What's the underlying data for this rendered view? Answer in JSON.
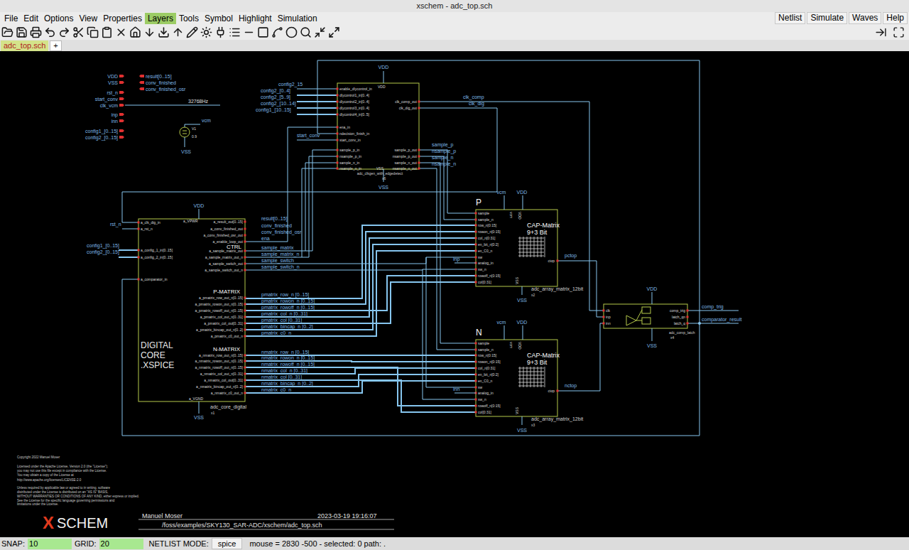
{
  "window": {
    "title": "xschem - adc_top.sch"
  },
  "menu": [
    {
      "label": "File",
      "selected": false
    },
    {
      "label": "Edit",
      "selected": false
    },
    {
      "label": "Options",
      "selected": false
    },
    {
      "label": "View",
      "selected": false
    },
    {
      "label": "Properties",
      "selected": false
    },
    {
      "label": "Layers",
      "selected": true
    },
    {
      "label": "Tools",
      "selected": false
    },
    {
      "label": "Symbol",
      "selected": false
    },
    {
      "label": "Highlight",
      "selected": false
    },
    {
      "label": "Simulation",
      "selected": false
    }
  ],
  "menu_right": [
    "Netlist",
    "Simulate",
    "Waves",
    "Help"
  ],
  "tabs": [
    {
      "label": "adc_top.sch",
      "selected": true
    }
  ],
  "new_tab": "+",
  "schematic": {
    "io_pins": {
      "inputs": [
        "VDD",
        "VSS",
        "rst_n",
        "start_conv",
        "clk_vcm",
        "inp",
        "inn",
        "config1_[0..15]",
        "config2_[0..15]"
      ],
      "outputs": [
        "result[0..15]",
        "conv_finished",
        "conv_finished_osr"
      ]
    },
    "clock_source": "32768Hz",
    "vsource": {
      "net": "vcm",
      "name": "V1",
      "value": "0.9",
      "ground": "VSS"
    },
    "clkgen": {
      "supply": "VDD",
      "supply_pin": "VDD",
      "ground": "VSS",
      "ground_pin": "VSS",
      "cell": "adc_clkgen_with_edgedetect",
      "instance": "x6",
      "left_pins": [
        "enable_dlycontrol_in",
        "dlycontrol1_in[0..4]",
        "dlycontrol2_in[0..4]",
        "dlycontrol3_in[0..4]",
        "dlycontrol4_in[0..5]",
        "ena_in",
        "ndecision_finish_in",
        "start_conv_in",
        "sample_p_in",
        "nsample_p_in",
        "sample_n_in",
        "nsample_n_in"
      ],
      "right_pins": [
        "clk_comp_out",
        "clk_dig_out",
        "sample_p_out",
        "nsample_p_out",
        "sample_n_out",
        "nsample_n_out"
      ],
      "left_nets": [
        "config2_15",
        "config2_[0..4]",
        "config2_[5..9]",
        "config2_[10..14]",
        "config1_[10..15]",
        "start_conv"
      ],
      "right_nets": [
        "clk_comp",
        "clk_dig",
        "sample_p",
        "nsample_p",
        "sample_n",
        "nsample_n"
      ]
    },
    "digital": {
      "supply": "VDD",
      "supply_pin": "a_VPWR",
      "ground": "VSS",
      "ground_pin": "a_VGND",
      "title": [
        "DIGITAL",
        "CORE",
        ".XSPICE"
      ],
      "cell": "adc_core_digital",
      "instance": "x1",
      "left_pins": [
        "a_clk_dig_in",
        "a_rst_n",
        "a_config_1_in[0..15]",
        "a_config_2_in[0..15]",
        "a_comparator_in"
      ],
      "left_nets": [
        "rst_n",
        "config1_[0..15]",
        "config2_[0..15]"
      ],
      "sections": [
        "CTRL",
        "P-MATRIX",
        "N-MATRIX"
      ],
      "right_pins": [
        "a_result_out[0..15]",
        "a_conv_finished_out",
        "a_conv_finished_osr_out",
        "a_enable_loop_out",
        "a_sample_matrix_out",
        "a_sample_matrix_out_n",
        "a_sample_switch_out",
        "a_sample_switch_out_n",
        "a_pmatrix_row_out_n[0..15]",
        "a_pmatrix_rowon_out_n[0..15]",
        "a_pmatrix_rowoff_out_n[0..15]",
        "a_pmatrix_col_out_n[0..31]",
        "a_pmatrix_col_out[0..31]",
        "a_pmatrix_bincap_out_n[0..2]",
        "a_pmatrix_c0_out_n",
        "a_nmatrix_row_out_n[0..15]",
        "a_nmatrix_rowon_out_n[0..15]",
        "a_nmatrix_rowoff_out_n[0..15]",
        "a_nmatrix_col_out_n[0..31]",
        "a_nmatrix_col_out[0..31]",
        "a_nmatrix_bincap_out_n[0..2]",
        "a_nmatrix_c0_out_n"
      ],
      "right_nets": [
        "result[0..15]",
        "conv_finished",
        "conv_finished_osr",
        "ena",
        "sample_matrix",
        "sample_matrix_n",
        "sample_switch",
        "sample_switch_n",
        "pmatrix_row_n [0..15]",
        "pmatrix_rowon_n [0..15]",
        "pmatrix_rowoff_n [0..15]",
        "pmatrix_col_n [0..31]",
        "pmatrix_col [0..31]",
        "pmatrix_bincap_n [0..2]",
        "pmatrix_c0_n",
        "nmatrix_row_n [0..15]",
        "nmatrix_rowon_n [0..15]",
        "nmatrix_rowoff_n [0..15]",
        "nmatrix_col_n [0..31]",
        "nmatrix_col [0..31]",
        "nmatrix_bincap_n [0..2]",
        "nmatrix_c0_n"
      ]
    },
    "cap_matrices": [
      {
        "label": "P",
        "title": "CAP-Matrix",
        "subtitle": "9+3 Bit",
        "pins": [
          "sample",
          "sample_n",
          "row_n[0:15]",
          "rowon_n[0:15]",
          "col_n[0:31]",
          "en_bit_n[0:2]",
          "en_C0_n",
          "sw",
          "analog_in",
          "sw_n",
          "rowoff_n[0:15]",
          "col[0:31]"
        ],
        "top_pins": [
          "vcm",
          "VDD"
        ],
        "top_nets": [
          "vcm",
          "VDD"
        ],
        "ground_pin": "VSS",
        "ground": "VSS",
        "out_pin": "ctop",
        "out_net": "pctop",
        "in_net": "inp",
        "cell": "adc_array_matrix_12bit",
        "instance": "x2"
      },
      {
        "label": "N",
        "title": "CAP-Matrix",
        "subtitle": "9+3 Bit",
        "pins": [
          "sample",
          "sample_n",
          "row_n[0:15]",
          "rowon_n[0:15]",
          "col_n[0:31]",
          "en_bit_n[0:2]",
          "en_C0_n",
          "sw",
          "analog_in",
          "sw_n",
          "rowoff_n[0:15]",
          "col[0:31]"
        ],
        "top_pins": [
          "vcm",
          "VDD"
        ],
        "top_nets": [
          "vcm",
          "VDD"
        ],
        "ground_pin": "VSS",
        "ground": "VSS",
        "out_pin": "ctop",
        "out_net": "nctop",
        "in_net": "inn",
        "cell": "adc_array_matrix_12bit",
        "instance": "x3"
      }
    ],
    "comparator": {
      "left_pins": [
        "clk",
        "inp",
        "inn"
      ],
      "right_pins": [
        "comp_trig",
        "latch_qn",
        "latch_q"
      ],
      "supply": "VDD",
      "ground": "VSS",
      "cell": "adc_comp_latch",
      "instance": "x4",
      "out_nets": [
        "comp_trig",
        "comparator_result"
      ]
    },
    "license": [
      "Copyright 2022 Manuel Moser",
      "Licensed under the Apache License, Version 2.0 (the \"License\");",
      "you may not use this file except in compliance with the License.",
      "You may obtain a copy of the License at",
      "    http://www.apache.org/licenses/LICENSE-2.0",
      "Unless required by applicable law or agreed to in writing, software",
      "distributed under the License is distributed on an \"AS IS\" BASIS,",
      "WITHOUT WARRANTIES OR CONDITIONS OF ANY KIND, either express or implied.",
      "See the License for the specific language governing permissions and",
      "limitations under the License."
    ],
    "title_block": {
      "logo_mark": "X",
      "logo_text": "SCHEM",
      "author": "Manuel Moser",
      "date": "2023-03-19  19:16:07",
      "path": "/foss/examples/SKY130_SAR-ADC/xschem/adc_top.sch"
    }
  },
  "status_bar": {
    "snap_label": "SNAP:",
    "snap": "10",
    "grid_label": "GRID:",
    "grid": "20",
    "mode_label": "NETLIST MODE:",
    "mode": "spice",
    "info": "mouse = 2830 -500 - selected: 0 path: ."
  }
}
